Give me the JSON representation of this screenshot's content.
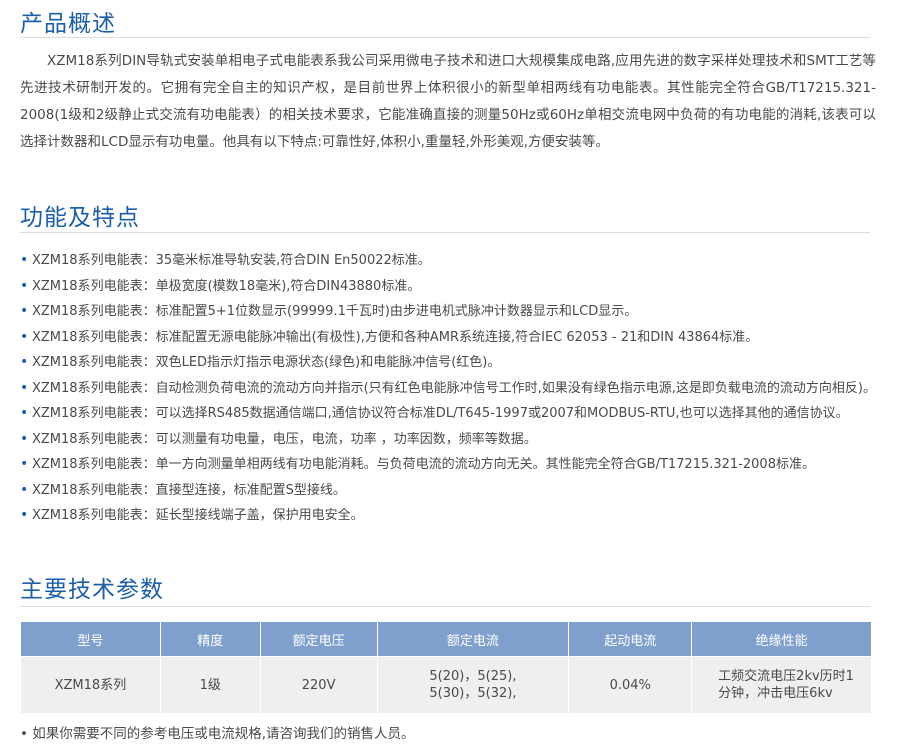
{
  "overview": {
    "title": "产品概述",
    "text": "XZM18系列DIN导轨式安装单相电子式电能表系我公司采用微电子技术和进口大规模集成电路,应用先进的数字采样处理技术和SMT工艺等先进技术研制开发的。它拥有完全自主的知识产权，是目前世界上体积很小的新型单相两线有功电能表。其性能完全符合GB/T17215.321-2008(1级和2级静止式交流有功电能表）的相关技术要求，它能准确直接的测量50Hz或60Hz单相交流电网中负荷的有功电能的消耗,该表可以选择计数器和LCD显示有功电量。他具有以下特点:可靠性好,体积小,重量轻,外形美观,方便安装等。"
  },
  "features": {
    "title": "功能及特点",
    "items": [
      {
        "label": "XZM18系列电能表：",
        "desc": "35毫米标准导轨安装,符合DIN En50022标准。"
      },
      {
        "label": "XZM18系列电能表：",
        "desc": "单极宽度(模数18毫米),符合DIN43880标准。"
      },
      {
        "label": "XZM18系列电能表：",
        "desc": "标准配置5+1位数显示(99999.1千瓦时)由步进电机式脉冲计数器显示和LCD显示。"
      },
      {
        "label": "XZM18系列电能表：",
        "desc": "标准配置无源电能脉冲输出(有极性),方便和各种AMR系统连接,符合IEC 62053 - 21和DIN 43864标准。"
      },
      {
        "label": "XZM18系列电能表：",
        "desc": "双色LED指示灯指示电源状态(绿色)和电能脉冲信号(红色)。"
      },
      {
        "label": "XZM18系列电能表：",
        "desc": "自动检测负荷电流的流动方向并指示(只有红色电能脉冲信号工作时,如果没有绿色指示电源,这是即负载电流的流动方向相反)。"
      },
      {
        "label": "XZM18系列电能表：",
        "desc": "可以选择RS485数据通信端口,通信协议符合标准DL/T645-1997或2007和MODBUS-RTU,也可以选择其他的通信协议。"
      },
      {
        "label": "XZM18系列电能表：",
        "desc": "可以测量有功电量，电压，电流，功率 ，功率因数，频率等数据。"
      },
      {
        "label": "XZM18系列电能表：",
        "desc": "单一方向测量单相两线有功电能消耗。与负荷电流的流动方向无关。其性能完全符合GB/T17215.321-2008标准。"
      },
      {
        "label": "XZM18系列电能表：",
        "desc": "直接型连接，标准配置S型接线。"
      },
      {
        "label": "XZM18系列电能表：",
        "desc": "延长型接线端子盖，保护用电安全。"
      }
    ]
  },
  "specs": {
    "title": "主要技术参数",
    "headers": [
      "型号",
      "精度",
      "额定电压",
      "额定电流",
      "起动电流",
      "绝缘性能"
    ],
    "row": [
      "XZM18系列",
      "1级",
      "220V",
      "5(20)，5(25),\n5(30)，5(32),",
      "0.04%",
      "工频交流电压2kv历时1分钟，冲击电压6kv"
    ],
    "note": "• 如果你需要不同的参考电压或电流规格,请咨询我们的销售人员。"
  }
}
